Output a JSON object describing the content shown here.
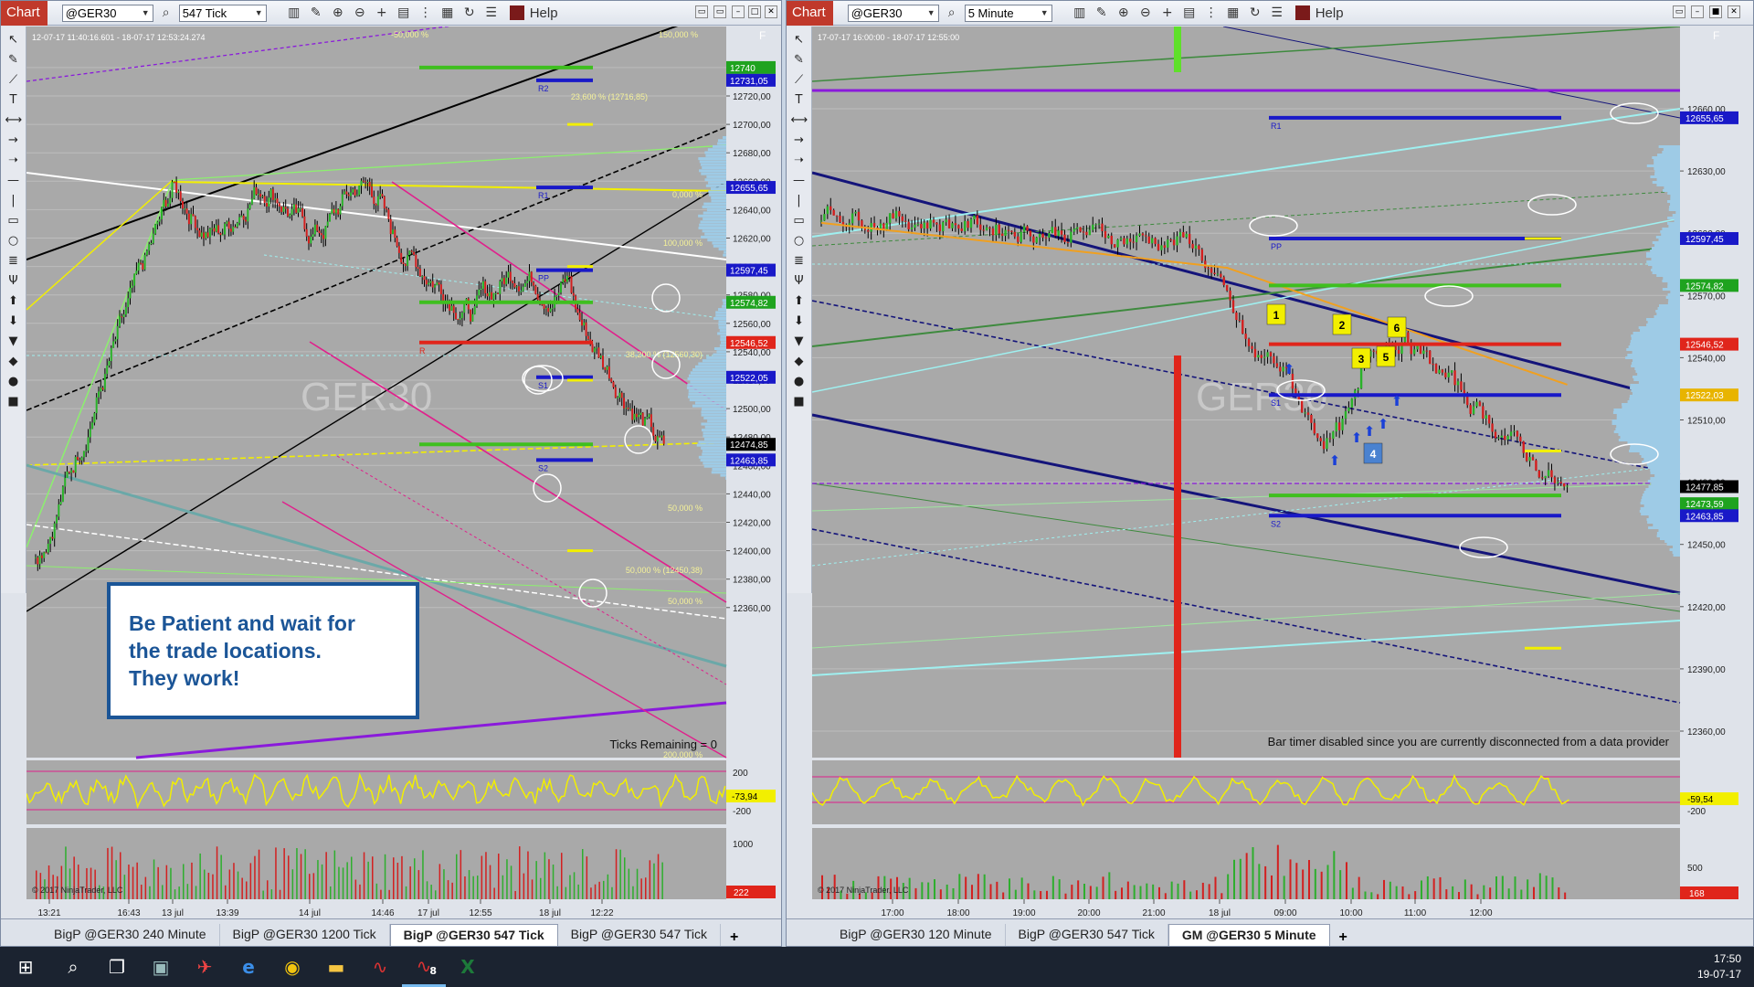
{
  "left": {
    "chart_button": "Chart",
    "instrument": "@GER30",
    "interval": "547 Tick",
    "help": "Help",
    "date_range": "12-07-17 11:40:16.601 - 18-07-17 12:53:24.274",
    "watermark": "GER30",
    "ticks_remaining": "Ticks Remaining = 0",
    "copyright": "© 2017 NinjaTrader, LLC",
    "note": {
      "line1": "Be Patient and wait for",
      "line2": "the trade locations.",
      "line3": "They work!"
    },
    "y_ticks": [
      "12740,00",
      "12720,00",
      "12700,00",
      "12680,00",
      "12660,00",
      "12640,00",
      "12620,00",
      "12600,00",
      "12580,00",
      "12560,00",
      "12540,00",
      "12520,00",
      "12500,00",
      "12480,00",
      "12460,00",
      "12440,00",
      "12420,00",
      "12400,00",
      "12380,00",
      "12360,00"
    ],
    "price_tags": [
      {
        "text": "12740",
        "color": "#1fa31f"
      },
      {
        "text": "12731,05",
        "color": "#1919c8"
      },
      {
        "text": "12655,65",
        "color": "#1919c8"
      },
      {
        "text": "12597,45",
        "color": "#1919c8"
      },
      {
        "text": "12574,82",
        "color": "#1fa31f"
      },
      {
        "text": "12546,52",
        "color": "#e0251b"
      },
      {
        "text": "12522,05",
        "color": "#1919c8"
      },
      {
        "text": "12474,85",
        "color": "#000000"
      },
      {
        "text": "12463,85",
        "color": "#1919c8"
      }
    ],
    "level_labels": [
      "R2",
      "R1",
      "PP",
      "R",
      "S1",
      "S2"
    ],
    "fib_labels": [
      "23,600 % (12716,85)",
      "0,000 %",
      "100,000 %",
      "38,200 % (12560,30)",
      "50,000 %",
      "50,000 % (12450,38)",
      "50,000 %",
      "-50,000 %",
      "150,000 %",
      "200,000 %"
    ],
    "x_ticks": [
      "13:21",
      "16:43",
      "13 jul",
      "13:39",
      "14 jul",
      "14:46",
      "17 jul",
      "12:55",
      "18 jul",
      "12:22"
    ],
    "osc_ticks": [
      "200",
      "-200"
    ],
    "osc_value": "-73,94",
    "vol_tick": "1000",
    "vol_value": "222",
    "tabs": [
      "BigP @GER30 240 Minute",
      "BigP @GER30 1200 Tick",
      "BigP @GER30 547 Tick",
      "BigP @GER30 547 Tick"
    ],
    "active_tab": 2,
    "tab_add": "+"
  },
  "right": {
    "chart_button": "Chart",
    "instrument": "@GER30",
    "interval": "5 Minute",
    "help": "Help",
    "date_range": "17-07-17 16:00:00 - 18-07-17 12:55:00",
    "watermark": "GER30",
    "bar_timer": "Bar timer disabled since you are currently disconnected from a data provider",
    "copyright": "© 2017 NinjaTrader, LLC",
    "y_ticks": [
      "12660,00",
      "12630,00",
      "12600,00",
      "12570,00",
      "12540,00",
      "12510,00",
      "12480,00",
      "12450,00",
      "12420,00",
      "12390,00",
      "12360,00"
    ],
    "price_tags": [
      {
        "text": "12655,65",
        "color": "#1919c8"
      },
      {
        "text": "12597,45",
        "color": "#1919c8"
      },
      {
        "text": "12574,82",
        "color": "#1fa31f"
      },
      {
        "text": "12546,52",
        "color": "#e0251b"
      },
      {
        "text": "12522,03",
        "color": "#e8b400"
      },
      {
        "text": "12477,85",
        "color": "#000000"
      },
      {
        "text": "12473,59",
        "color": "#1fa31f"
      },
      {
        "text": "12463,85",
        "color": "#1919c8"
      }
    ],
    "level_labels": [
      "R1",
      "PP",
      "S1",
      "S2"
    ],
    "markers": [
      "1",
      "2",
      "3",
      "4",
      "5",
      "6"
    ],
    "x_ticks": [
      "17:00",
      "18:00",
      "19:00",
      "20:00",
      "21:00",
      "18 jul",
      "09:00",
      "10:00",
      "11:00",
      "12:00"
    ],
    "osc_ticks": [
      "-200"
    ],
    "osc_value": "-59,54",
    "vol_tick": "500",
    "vol_value": "168",
    "tabs": [
      "BigP @GER30 120 Minute",
      "BigP @GER30 547 Tick",
      "GM @GER30 5 Minute"
    ],
    "active_tab": 2,
    "tab_add": "+"
  },
  "taskbar": {
    "time": "17:50",
    "date": "19-07-17",
    "badge": "8"
  },
  "colors": {
    "chart_bg": "#a9a9a9",
    "up": "#1f8f1f",
    "down": "#c81e1e",
    "blue_level": "#1919c8",
    "green_level": "#3fbf1f",
    "red_level": "#e0251b",
    "yellow": "#f2ef00",
    "magenta": "#e0208c",
    "purple": "#8a1adb",
    "cyan": "#9ff0f0",
    "navy": "#14147a",
    "vp": "#9ecbe6",
    "note_border": "#1b5597"
  }
}
